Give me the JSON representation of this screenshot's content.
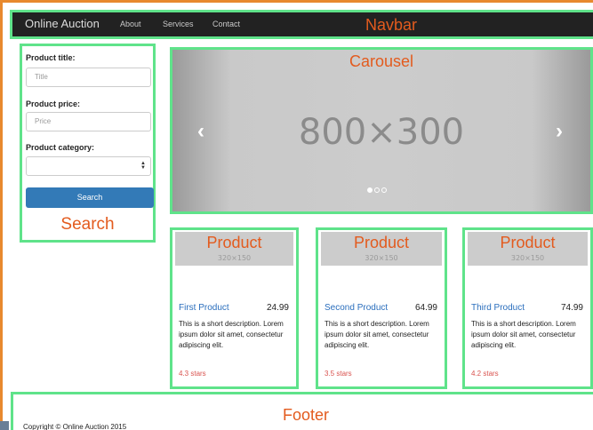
{
  "navbar": {
    "brand": "Online Auction",
    "links": [
      "About",
      "Services",
      "Contact"
    ],
    "annotation": "Navbar"
  },
  "search": {
    "title_label": "Product title:",
    "title_placeholder": "Title",
    "price_label": "Product price:",
    "price_placeholder": "Price",
    "category_label": "Product category:",
    "category_value": "",
    "button_label": "Search",
    "annotation": "Search"
  },
  "carousel": {
    "placeholder": "800×300",
    "prev_glyph": "‹",
    "next_glyph": "›",
    "slide_count": 3,
    "active_slide": 1,
    "annotation": "Carousel"
  },
  "products": [
    {
      "annotation": "Product",
      "thumb": "320×150",
      "title": "First Product",
      "price": "24.99",
      "description": "This is a short description. Lorem ipsum dolor sit amet, consectetur adipiscing elit.",
      "rating": "4.3 stars"
    },
    {
      "annotation": "Product",
      "thumb": "320×150",
      "title": "Second Product",
      "price": "64.99",
      "description": "This is a short description. Lorem ipsum dolor sit amet, consectetur adipiscing elit.",
      "rating": "3.5 stars"
    },
    {
      "annotation": "Product",
      "thumb": "320×150",
      "title": "Third Product",
      "price": "74.99",
      "description": "This is a short description. Lorem ipsum dolor sit amet, consectetur adipiscing elit.",
      "rating": "4.2 stars"
    }
  ],
  "footer": {
    "annotation": "Footer",
    "copyright": "Copyright © Online Auction 2015"
  },
  "colors": {
    "annotation_box": "#5fe38a",
    "annotation_text": "#e35b1e",
    "frame": "#e8892e",
    "primary": "#337ab7",
    "link": "#2a6ebd",
    "rating": "#d9534f",
    "navbar_bg": "#222222"
  }
}
